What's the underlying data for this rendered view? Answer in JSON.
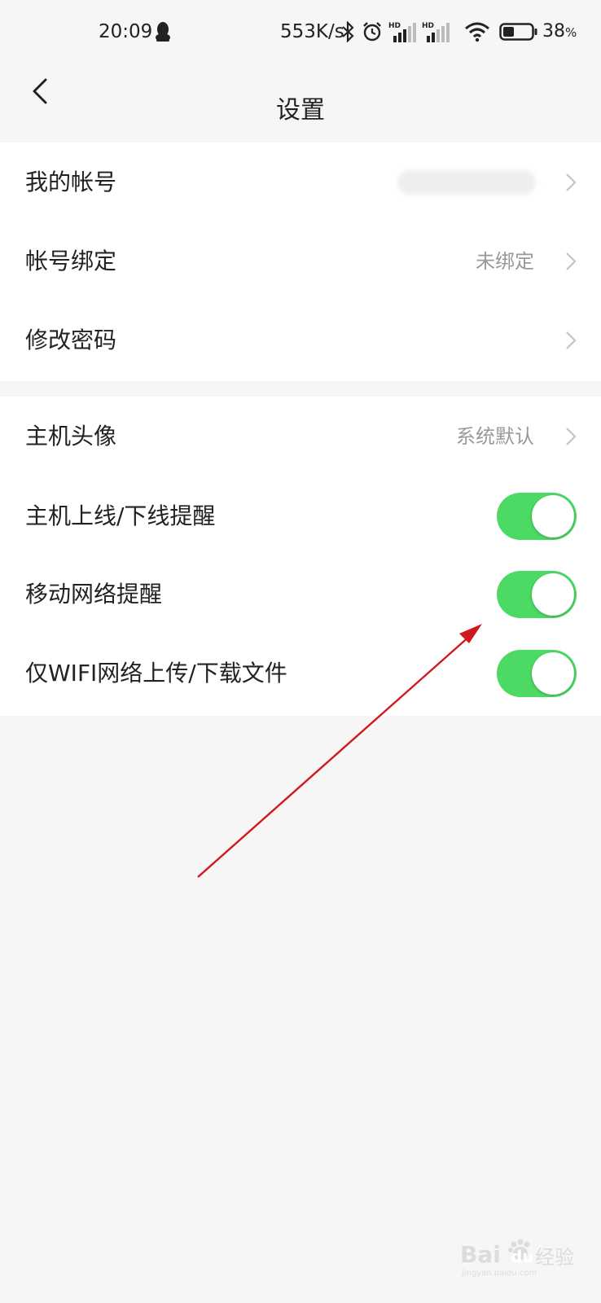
{
  "status_bar": {
    "time": "20:09",
    "speed": "553K/s",
    "network_badge_1": "HD",
    "network_badge_2": "HD",
    "battery_value": "38",
    "battery_unit": "%",
    "battery_level": 0.38
  },
  "nav": {
    "title": "设置"
  },
  "group1": [
    {
      "label": "我的帐号",
      "value": ""
    },
    {
      "label": "帐号绑定",
      "value": "未绑定"
    },
    {
      "label": "修改密码",
      "value": ""
    }
  ],
  "group2": [
    {
      "label": "主机头像",
      "value": "系统默认"
    },
    {
      "label": "主机上线/下线提醒",
      "on": true
    },
    {
      "label": "移动网络提醒",
      "on": true
    },
    {
      "label": "仅WIFI网络上传/下载文件",
      "on": true
    }
  ],
  "watermark": {
    "brand": "Bai",
    "brand2": "du",
    "suffix": "经验",
    "url": "jingyan.baidu.com"
  },
  "colors": {
    "toggle_on": "#4cd964",
    "annotation_arrow": "#d0191d",
    "background": "#f6f6f6"
  }
}
